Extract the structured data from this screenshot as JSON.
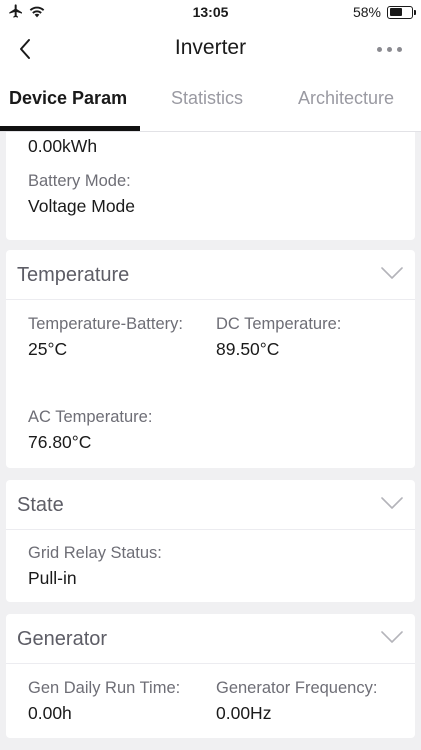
{
  "status_bar": {
    "time": "13:05",
    "battery_percent_text": "58%",
    "battery_level": 0.58,
    "icons": [
      "airplane-icon",
      "wifi-icon",
      "battery-icon"
    ]
  },
  "nav": {
    "title": "Inverter",
    "back_icon": "chevron-left-icon",
    "more_icon": "more-dots-icon"
  },
  "tabs": [
    {
      "label": "Device Param",
      "active": true
    },
    {
      "label": "Statistics",
      "active": false
    },
    {
      "label": "Architecture",
      "active": false
    }
  ],
  "battery_card": {
    "partial_value": "0.00kWh",
    "battery_mode_label": "Battery Mode:",
    "battery_mode_value": "Voltage Mode"
  },
  "temperature_card": {
    "title": "Temperature",
    "fields": [
      {
        "label": "Temperature-Battery:",
        "value": "25°C"
      },
      {
        "label": "DC Temperature:",
        "value": "89.50°C"
      },
      {
        "label": "AC Temperature:",
        "value": "76.80°C"
      }
    ]
  },
  "state_card": {
    "title": "State",
    "fields": [
      {
        "label": "Grid Relay Status:",
        "value": "Pull-in"
      }
    ]
  },
  "generator_card": {
    "title": "Generator",
    "fields": [
      {
        "label": "Gen Daily Run Time:",
        "value": "0.00h"
      },
      {
        "label": "Generator Frequency:",
        "value": "0.00Hz"
      }
    ]
  },
  "colors": {
    "background": "#f0f0f2",
    "card": "#ffffff",
    "section_title": "#5d5d66",
    "label": "#6e6e76",
    "value": "#1a1a1a",
    "inactive_tab": "#9a9aa2",
    "active_underline": "#111111"
  }
}
